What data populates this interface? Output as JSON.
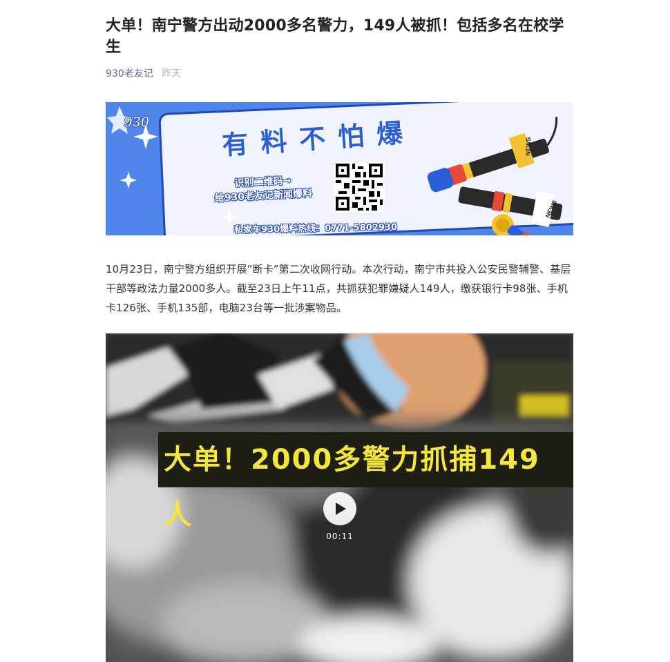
{
  "article": {
    "title": "大单！南宁警方出动2000多名警力，149人被抓！包括多名在校学生",
    "author": "930老友记",
    "time": "昨天",
    "paragraph": "10月23日，南宁警方组织开展”断卡”第二次收网行动。本次行动，南宁市共投入公安民警辅警、基层干部等政法力量2000多人。截至23日上午11点，共抓获犯罪嫌疑人149人，缴获银行卡98张、手机卡126张、手机135部，电脑23台等一批涉案物品。"
  },
  "banner": {
    "logo_text": "930",
    "headline": "有料不怕爆",
    "scan_line1": "识别二维码→",
    "scan_line2": "给930老友记新闻爆料",
    "hotline": "私家车930爆料热线：0771-5802930",
    "mic_label_1": "NEWS",
    "mic_label_2": "NEWS",
    "colors": {
      "background": "#4f86ec",
      "card": "#eef3fd",
      "accent": "#2a5ed6"
    }
  },
  "video": {
    "caption": "大单！2000多警力抓捕149人",
    "duration": "00:11",
    "play_icon": "play-icon"
  },
  "colors": {
    "link": "#576b95",
    "muted": "#b2b2b2",
    "title": "#222222",
    "body": "#333333"
  }
}
